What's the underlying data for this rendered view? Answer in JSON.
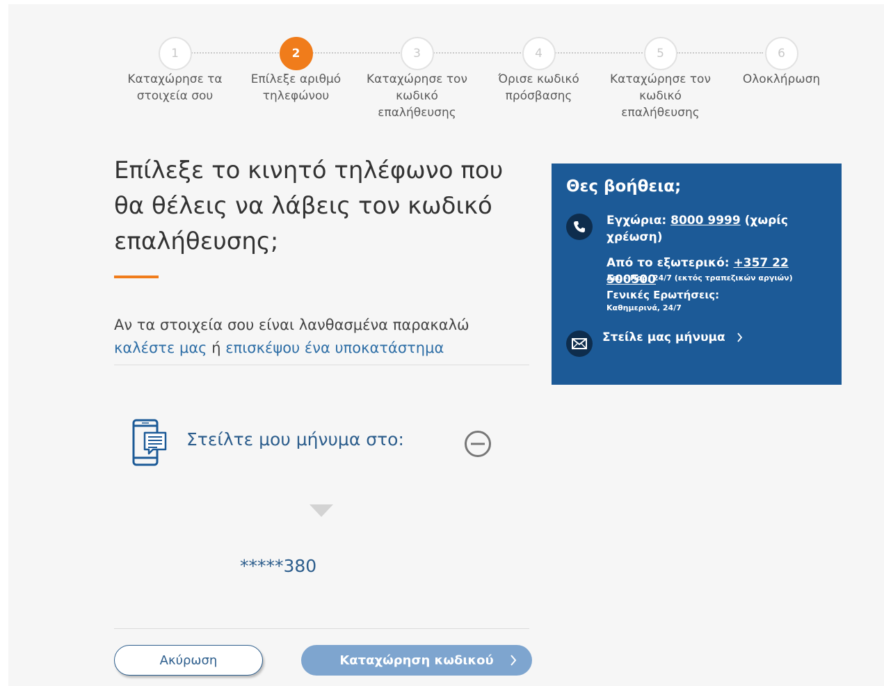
{
  "steps": [
    {
      "number": "1",
      "label": "Καταχώρησε τα στοιχεία σου",
      "state": "done"
    },
    {
      "number": "2",
      "label": "Επίλεξε αριθμό τηλεφώνου",
      "state": "active"
    },
    {
      "number": "3",
      "label": "Καταχώρησε τον κωδικό επαλήθευσης",
      "state": "pending"
    },
    {
      "number": "4",
      "label": "Όρισε κωδικό πρόσβασης",
      "state": "pending"
    },
    {
      "number": "5",
      "label": "Καταχώρησε τον κωδικό επαλήθευσης",
      "state": "pending"
    },
    {
      "number": "6",
      "label": "Ολοκλήρωση",
      "state": "pending"
    }
  ],
  "main": {
    "title": "Επίλεξε το κινητό τηλέφωνο που θα θέλεις να λάβεις τον κωδικό επαλήθευσης;",
    "info_prefix": "Αν τα στοιχεία σου είναι λανθασμένα παρακαλώ",
    "call_link": "καλέστε μας",
    "info_or": "ή",
    "branch_link": "επισκέψου ένα υποκατάστημα",
    "sms_label": "Στείλτε μου μήνυμα στο:",
    "masked_number": "*****380"
  },
  "buttons": {
    "cancel": "Ακύρωση",
    "submit": "Καταχώρηση κωδικού"
  },
  "help": {
    "title": "Θες βοήθεια;",
    "local_label": "Εγχώρια:",
    "local_number": "8000 9999",
    "local_note": "(χωρίς χρέωση)",
    "abroad_label": "Από το εξωτερικό:",
    "abroad_number": "+357 22 500500",
    "abroad_hours": "Δευ - Παρ, 24/7 (εκτός τραπεζικών αργιών)",
    "general_label": "Γενικές Ερωτήσεις:",
    "general_hours": "Καθημερινά, 24/7",
    "message_link": "Στείλε μας μήνυμα"
  },
  "colors": {
    "accent": "#f07c1b",
    "primary": "#1c5a97",
    "link": "#2e6ea6",
    "submit_disabled": "#7ea5cf"
  }
}
